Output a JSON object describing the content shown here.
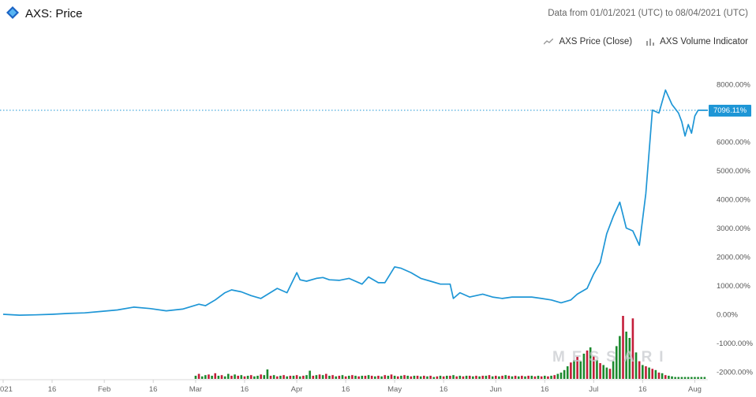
{
  "header": {
    "title": "AXS: Price",
    "range": "Data from 01/01/2021 (UTC) to 08/04/2021 (UTC)"
  },
  "legend": {
    "price_label": "AXS Price (Close)",
    "volume_label": "AXS Volume Indicator"
  },
  "watermark": "MESSARI",
  "last_value_label": "7096.11%",
  "colors": {
    "line": "#1e96d6",
    "up": "#1d8a2f",
    "down": "#c41e3a",
    "grid": "#e6e6e6"
  },
  "chart_data": {
    "type": "line",
    "title": "AXS: Price",
    "y_unit": "%",
    "ylim": [
      -2200,
      8600
    ],
    "y_ticks": [
      "8000.00%",
      "7000.00%",
      "6000.00%",
      "5000.00%",
      "4000.00%",
      "3000.00%",
      "2000.00%",
      "1000.00%",
      "0.00%",
      "-1000.00%",
      "-2000.00%"
    ],
    "y_tick_values": [
      8000,
      7000,
      6000,
      5000,
      4000,
      3000,
      2000,
      1000,
      0,
      -1000,
      -2000
    ],
    "x_ticks": [
      "021",
      "16",
      "Feb",
      "16",
      "Mar",
      "16",
      "Apr",
      "16",
      "May",
      "16",
      "Jun",
      "16",
      "Jul",
      "16",
      "Aug"
    ],
    "x_tick_days": [
      1,
      16,
      32,
      47,
      60,
      75,
      91,
      106,
      121,
      136,
      152,
      167,
      182,
      197,
      213
    ],
    "series": [
      {
        "name": "AXS Price (Close)",
        "x_day": [
          1,
          6,
          11,
          16,
          21,
          26,
          31,
          36,
          41,
          46,
          51,
          56,
          61,
          63,
          66,
          69,
          71,
          74,
          77,
          80,
          85,
          88,
          91,
          92,
          94,
          97,
          99,
          101,
          104,
          107,
          111,
          113,
          116,
          118,
          121,
          123,
          126,
          129,
          132,
          135,
          138,
          139,
          141,
          144,
          148,
          151,
          154,
          157,
          160,
          163,
          166,
          169,
          172,
          175,
          177,
          180,
          182,
          184,
          186,
          188,
          190,
          192,
          194,
          196,
          198,
          200,
          202,
          204,
          206,
          208,
          209,
          210,
          211,
          212,
          213,
          214,
          215,
          216,
          217
        ],
        "values": [
          0,
          -30,
          -20,
          0,
          30,
          50,
          100,
          150,
          250,
          200,
          120,
          180,
          350,
          300,
          500,
          750,
          850,
          780,
          650,
          550,
          900,
          750,
          1450,
          1200,
          1150,
          1250,
          1280,
          1200,
          1180,
          1250,
          1050,
          1300,
          1100,
          1100,
          1650,
          1600,
          1450,
          1250,
          1150,
          1050,
          1050,
          550,
          750,
          600,
          700,
          600,
          550,
          600,
          600,
          600,
          550,
          500,
          400,
          500,
          700,
          900,
          1400,
          1800,
          2800,
          3400,
          3900,
          3000,
          2900,
          2400,
          4200,
          7100,
          7000,
          7800,
          7300,
          7000,
          6700,
          6200,
          6600,
          6300,
          6900,
          7096,
          7096,
          7096,
          7096
        ]
      }
    ],
    "volume": {
      "name": "AXS Volume Indicator",
      "x_day": [
        60,
        61,
        62,
        63,
        64,
        65,
        66,
        67,
        68,
        69,
        70,
        71,
        72,
        73,
        74,
        75,
        76,
        77,
        78,
        79,
        80,
        81,
        82,
        83,
        84,
        85,
        86,
        87,
        88,
        89,
        90,
        91,
        92,
        93,
        94,
        95,
        96,
        97,
        98,
        99,
        100,
        101,
        102,
        103,
        104,
        105,
        106,
        107,
        108,
        109,
        110,
        111,
        112,
        113,
        114,
        115,
        116,
        117,
        118,
        119,
        120,
        121,
        122,
        123,
        124,
        125,
        126,
        127,
        128,
        129,
        130,
        131,
        132,
        133,
        134,
        135,
        136,
        137,
        138,
        139,
        140,
        141,
        142,
        143,
        144,
        145,
        146,
        147,
        148,
        149,
        150,
        151,
        152,
        153,
        154,
        155,
        156,
        157,
        158,
        159,
        160,
        161,
        162,
        163,
        164,
        165,
        166,
        167,
        168,
        169,
        170,
        171,
        172,
        173,
        174,
        175,
        176,
        177,
        178,
        179,
        180,
        181,
        182,
        183,
        184,
        185,
        186,
        187,
        188,
        189,
        190,
        191,
        192,
        193,
        194,
        195,
        196,
        197,
        198,
        199,
        200,
        201,
        202,
        203,
        204,
        205,
        206,
        207,
        208,
        209,
        210,
        211,
        212,
        213,
        214,
        215,
        216
      ],
      "values": [
        0.05,
        0.08,
        0.04,
        0.06,
        0.07,
        0.05,
        0.09,
        0.05,
        0.06,
        0.04,
        0.08,
        0.05,
        0.07,
        0.05,
        0.06,
        0.04,
        0.05,
        0.06,
        0.04,
        0.05,
        0.07,
        0.06,
        0.15,
        0.05,
        0.06,
        0.04,
        0.05,
        0.06,
        0.04,
        0.05,
        0.05,
        0.06,
        0.04,
        0.05,
        0.06,
        0.13,
        0.05,
        0.06,
        0.07,
        0.06,
        0.08,
        0.05,
        0.06,
        0.04,
        0.05,
        0.06,
        0.04,
        0.05,
        0.06,
        0.05,
        0.04,
        0.05,
        0.05,
        0.06,
        0.05,
        0.04,
        0.05,
        0.04,
        0.06,
        0.05,
        0.07,
        0.05,
        0.04,
        0.05,
        0.06,
        0.05,
        0.04,
        0.05,
        0.05,
        0.04,
        0.05,
        0.04,
        0.05,
        0.03,
        0.04,
        0.05,
        0.04,
        0.05,
        0.05,
        0.06,
        0.04,
        0.05,
        0.04,
        0.05,
        0.05,
        0.04,
        0.05,
        0.04,
        0.05,
        0.05,
        0.06,
        0.04,
        0.05,
        0.04,
        0.05,
        0.06,
        0.05,
        0.04,
        0.05,
        0.04,
        0.05,
        0.04,
        0.05,
        0.05,
        0.04,
        0.05,
        0.04,
        0.05,
        0.04,
        0.05,
        0.06,
        0.08,
        0.1,
        0.14,
        0.2,
        0.26,
        0.3,
        0.35,
        0.28,
        0.4,
        0.45,
        0.5,
        0.36,
        0.3,
        0.25,
        0.22,
        0.18,
        0.16,
        0.28,
        0.52,
        0.68,
        1.0,
        0.75,
        0.65,
        0.96,
        0.42,
        0.28,
        0.22,
        0.2,
        0.18,
        0.16,
        0.14,
        0.1,
        0.09,
        0.06,
        0.05,
        0.04,
        0.03,
        0.03,
        0.03,
        0.03,
        0.03,
        0.03,
        0.03,
        0.03,
        0.03,
        0.03
      ],
      "colors": [
        "up",
        "down",
        "up",
        "up",
        "down",
        "up",
        "down",
        "up",
        "down",
        "up",
        "up",
        "down",
        "up",
        "down",
        "up",
        "down",
        "up",
        "down",
        "up",
        "up",
        "down",
        "up",
        "up",
        "down",
        "up",
        "down",
        "up",
        "down",
        "up",
        "down",
        "up",
        "down",
        "up",
        "down",
        "up",
        "up",
        "down",
        "up",
        "down",
        "up",
        "down",
        "up",
        "down",
        "up",
        "down",
        "up",
        "down",
        "up",
        "down",
        "up",
        "down",
        "up",
        "down",
        "up",
        "down",
        "up",
        "down",
        "up",
        "down",
        "up",
        "down",
        "up",
        "down",
        "up",
        "down",
        "up",
        "down",
        "up",
        "down",
        "up",
        "down",
        "up",
        "down",
        "up",
        "down",
        "up",
        "down",
        "up",
        "down",
        "up",
        "down",
        "up",
        "down",
        "up",
        "down",
        "up",
        "down",
        "up",
        "down",
        "up",
        "down",
        "up",
        "down",
        "up",
        "down",
        "up",
        "down",
        "up",
        "down",
        "up",
        "down",
        "up",
        "down",
        "up",
        "down",
        "up",
        "down",
        "up",
        "down",
        "up",
        "down",
        "up",
        "up",
        "up",
        "up",
        "down",
        "up",
        "down",
        "up",
        "up",
        "down",
        "up",
        "down",
        "up",
        "down",
        "up",
        "up",
        "down",
        "up",
        "up",
        "up",
        "down",
        "up",
        "up",
        "down",
        "up",
        "down",
        "up",
        "down",
        "up",
        "down",
        "up",
        "down",
        "up",
        "down",
        "up",
        "up",
        "up",
        "up",
        "up",
        "up",
        "up",
        "up",
        "up"
      ]
    }
  }
}
